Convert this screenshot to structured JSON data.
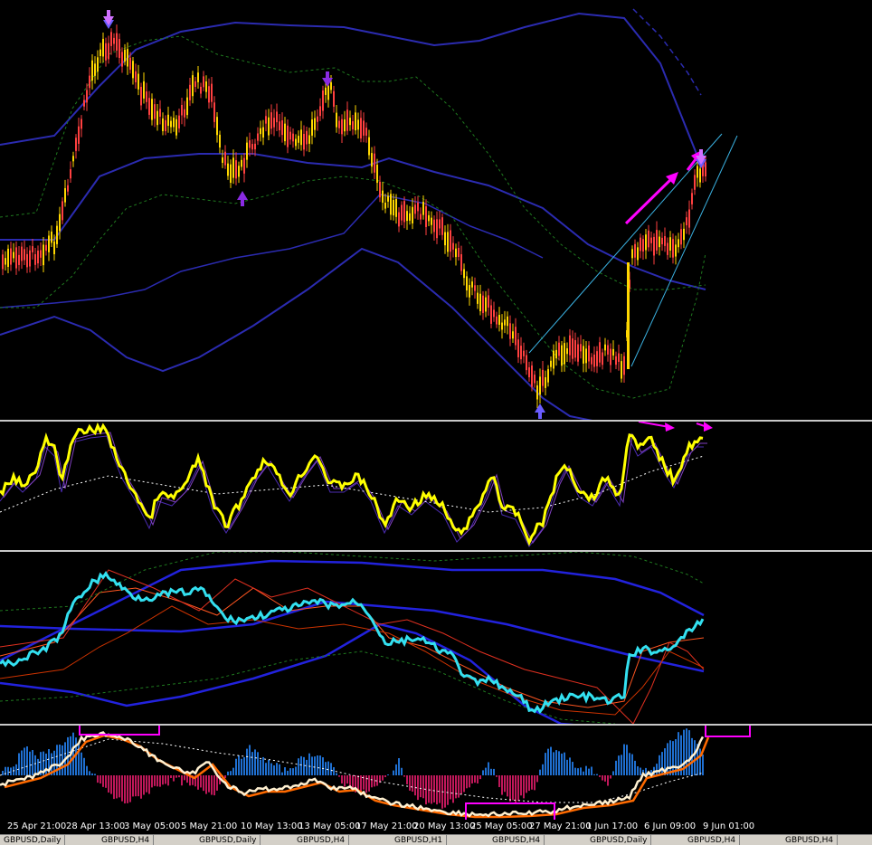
{
  "axis": {
    "time_labels": [
      "25 Apr 21:00",
      "28 Apr 13:00",
      "3 May 05:00",
      "5 May 21:00",
      "10 May 13:00",
      "13 May 05:00",
      "17 May 21:00",
      "20 May 13:00",
      "25 May 05:00",
      "27 May 21:00",
      "1 Jun 17:00",
      "6 Jun 09:00",
      "9 Jun 01:00"
    ]
  },
  "tabs": [
    "GBPUSD,Daily",
    "GBPUSD,H4",
    "GBPUSD,Daily",
    "GBPUSD,H4",
    "GBPUSD,H1",
    "GBPUSD,H4",
    "GBPUSD,Daily",
    "GBPUSD,H4",
    "GBPUSD,H4"
  ],
  "colors": {
    "background": "#000000",
    "bull_candle": "#ffd700",
    "bear_candle": "#ff4040",
    "bands_blue": "#2b2bb0",
    "bands_green": "#1f7a1f",
    "rsi_line": "#ffff00",
    "cci_line": "#33e0f0",
    "signal_magenta": "#ff00ff",
    "hist_up": "#1f6fd0",
    "hist_down": "#c0185a",
    "trend_line": "#3ab0e0"
  },
  "icons": {
    "arrow_up_marker": "up-arrow-icon",
    "arrow_down_marker": "down-arrow-icon"
  }
}
